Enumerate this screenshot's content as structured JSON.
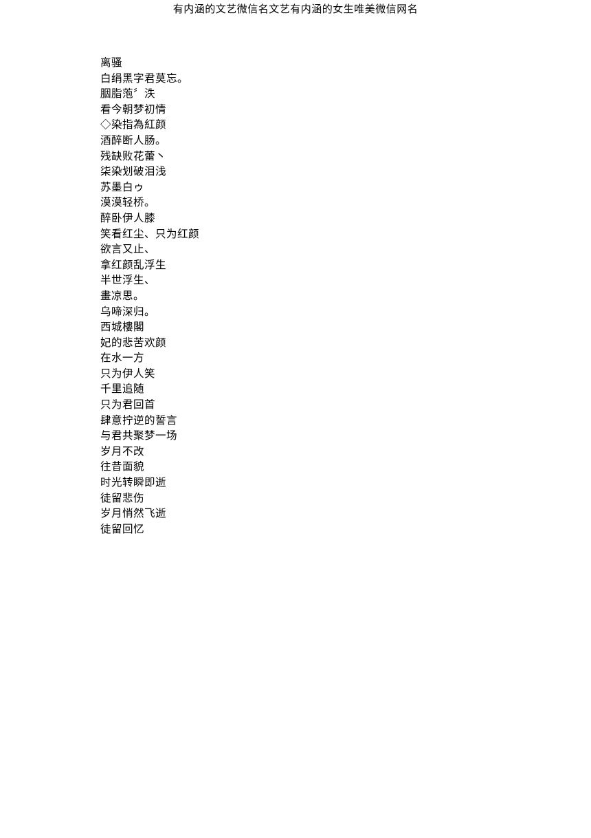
{
  "title": "有内涵的文艺微信名文艺有内涵的女生唯美微信网名",
  "lines": [
    "离骚",
    "白绢黑字君莫忘。",
    "胭脂萢〞泆",
    "看今朝梦初情",
    "◇染指為紅颜",
    "酒醉断人肠。",
    "残缺败花蕾丶",
    "柒染划破泪浅",
    "苏墨白ゥ",
    "漠漠轻桥。",
    "醉卧伊人膝",
    "笑看红尘、只为红颜",
    "欲言又止、",
    "拿红颜乱浮生",
    "半世浮生、",
    "畫凉思。",
    "乌啼深归。",
    "西城樓閣",
    "妃的悲苦欢颜",
    "在水一方",
    "只为伊人笑",
    "千里追随",
    "只为君回首",
    "肆意拧逆的誓言",
    "与君共聚梦一场",
    "岁月不改",
    "往昔面貌",
    "时光转瞬即逝",
    "徒留悲伤",
    "岁月悄然飞逝",
    "徒留回忆"
  ]
}
